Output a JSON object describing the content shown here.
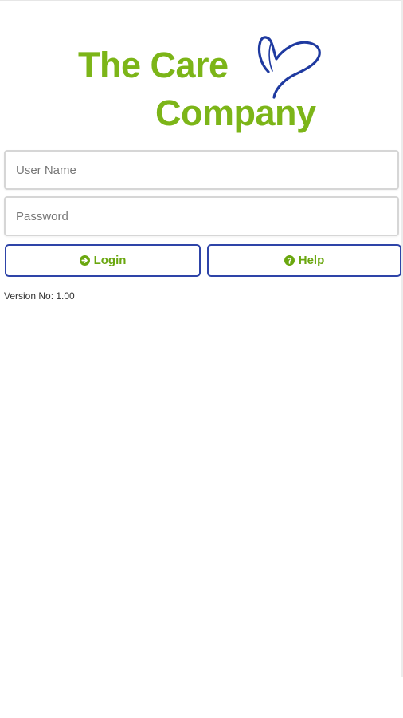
{
  "logo": {
    "line1": "The Care",
    "line2": "Company",
    "heart_icon": "heart-outline-icon"
  },
  "login_form": {
    "username_placeholder": "User Name",
    "username_value": "",
    "password_placeholder": "Password",
    "password_value": ""
  },
  "buttons": {
    "login": {
      "label": "Login",
      "icon": "circle-arrow-right-icon"
    },
    "help": {
      "label": "Help",
      "icon": "circle-question-icon"
    }
  },
  "footer": {
    "version": "Version No: 1.00"
  },
  "colors": {
    "brand_green": "#7cb518",
    "brand_blue": "#2e44a8",
    "field_border": "#d6d6d6"
  }
}
